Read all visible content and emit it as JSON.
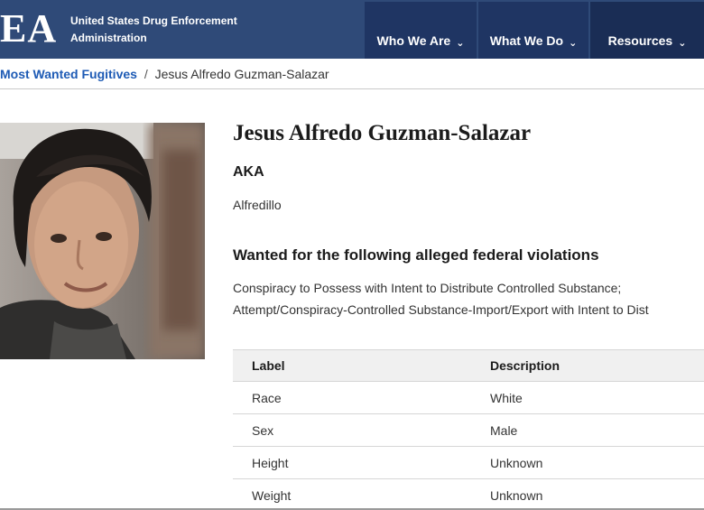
{
  "header": {
    "logo_mark": "EA",
    "logo_line1": "United States Drug Enforcement",
    "logo_line2": "Administration",
    "nav": [
      {
        "label": "Who We Are"
      },
      {
        "label": "What We Do"
      },
      {
        "label": "Resources"
      }
    ]
  },
  "breadcrumb": {
    "parent": "Most Wanted Fugitives",
    "separator": "/",
    "current": "Jesus Alfredo Guzman-Salazar"
  },
  "profile": {
    "name": "Jesus Alfredo Guzman-Salazar",
    "aka_label": "AKA",
    "aka_value": "Alfredillo",
    "wanted_heading": "Wanted for the following alleged federal violations",
    "violations": [
      "Conspiracy to Possess with Intent to Distribute Controlled Substance;",
      "Attempt/Conspiracy-Controlled Substance-Import/Export with Intent to Dist"
    ]
  },
  "table": {
    "headers": [
      "Label",
      "Description"
    ],
    "rows": [
      [
        "Race",
        "White"
      ],
      [
        "Sex",
        "Male"
      ],
      [
        "Height",
        "Unknown"
      ],
      [
        "Weight",
        "Unknown"
      ]
    ]
  },
  "colors": {
    "header_bg": "#2f4a78",
    "nav_bg": "#1f3563",
    "link": "#1e5bb5"
  }
}
